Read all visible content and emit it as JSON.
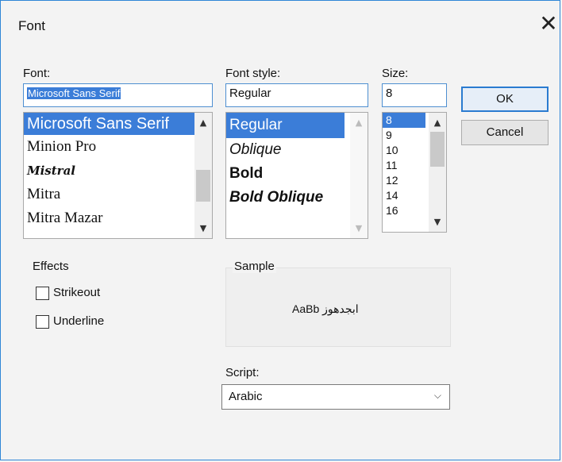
{
  "dialog": {
    "title": "Font"
  },
  "font": {
    "label": "Font:",
    "value": "Microsoft Sans Serif",
    "items": [
      "Microsoft Sans Serif",
      "Minion Pro",
      "Mistral",
      "Mitra",
      "Mitra Mazar"
    ],
    "selected_index": 0
  },
  "style": {
    "label": "Font style:",
    "value": "Regular",
    "items": [
      "Regular",
      "Oblique",
      "Bold",
      "Bold Oblique"
    ],
    "selected_index": 0
  },
  "size": {
    "label": "Size:",
    "value": "8",
    "items": [
      "8",
      "9",
      "10",
      "11",
      "12",
      "14",
      "16"
    ],
    "selected_index": 0
  },
  "buttons": {
    "ok": "OK",
    "cancel": "Cancel"
  },
  "effects": {
    "label": "Effects",
    "strikeout": "Strikeout",
    "underline": "Underline",
    "strikeout_checked": false,
    "underline_checked": false
  },
  "sample": {
    "label": "Sample",
    "text": "AaBb ابجدهوز"
  },
  "script": {
    "label": "Script:",
    "value": "Arabic"
  },
  "icons": {
    "close": "close-icon",
    "scroll_up": "chevron-up-icon",
    "scroll_down": "chevron-down-icon",
    "combo": "chevron-down-icon"
  },
  "colors": {
    "accent": "#2f86d6",
    "selection": "#3b7dd8"
  }
}
